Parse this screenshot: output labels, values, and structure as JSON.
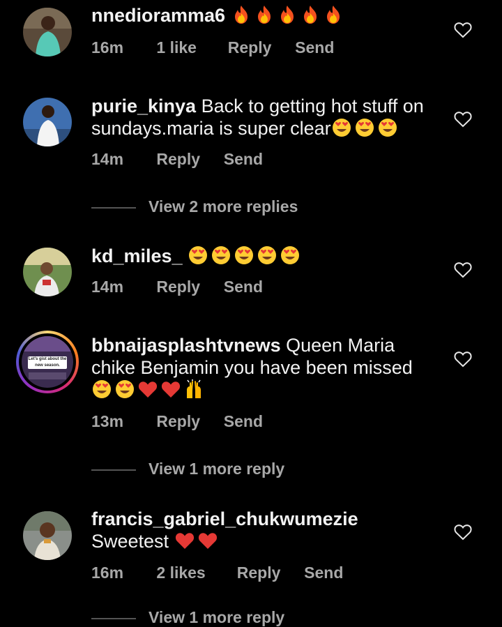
{
  "comments": [
    {
      "username": "nnedioramma6",
      "text": "",
      "emojis": [
        "fire",
        "fire",
        "fire",
        "fire",
        "fire"
      ],
      "time": "16m",
      "likes": "1 like",
      "reply": "Reply",
      "send": "Send",
      "avatar_icon": "user-avatar-woman-teal-dress"
    },
    {
      "username": "purie_kinya",
      "text": "Back to getting hot stuff on sundays.maria is super clear",
      "emojis": [
        "heart-eyes",
        "heart-eyes",
        "heart-eyes"
      ],
      "time": "14m",
      "reply": "Reply",
      "send": "Send",
      "avatar_icon": "user-avatar-woman-white-top",
      "view_replies": "View 2 more replies"
    },
    {
      "username": "kd_miles_",
      "text": "",
      "emojis": [
        "heart-eyes",
        "heart-eyes",
        "heart-eyes",
        "heart-eyes",
        "heart-eyes"
      ],
      "time": "14m",
      "reply": "Reply",
      "send": "Send",
      "avatar_icon": "user-avatar-man-outdoors"
    },
    {
      "username": "bbnaijasplashtvnews",
      "text": "Queen Maria chike Benjamin you have been missed",
      "emojis": [
        "heart-eyes",
        "heart-eyes",
        "red-heart",
        "red-heart",
        "raising-hands"
      ],
      "time": "13m",
      "reply": "Reply",
      "send": "Send",
      "avatar_icon": "story-ring-avatar",
      "avatar_caption": "Let's gist about the new season.",
      "view_replies": "View 1 more reply"
    },
    {
      "username": "francis_gabriel_chukwumezie",
      "text": "Sweetest",
      "emojis": [
        "red-heart",
        "red-heart"
      ],
      "time": "16m",
      "likes": "2 likes",
      "reply": "Reply",
      "send": "Send",
      "avatar_icon": "user-avatar-man-portrait",
      "view_replies": "View 1 more reply"
    }
  ],
  "colors": {
    "background": "#000000",
    "text": "#f2f2f2",
    "meta": "#a8a8a8",
    "story_ring": "#d62976"
  },
  "icons": {
    "like": "heart-outline-icon"
  }
}
